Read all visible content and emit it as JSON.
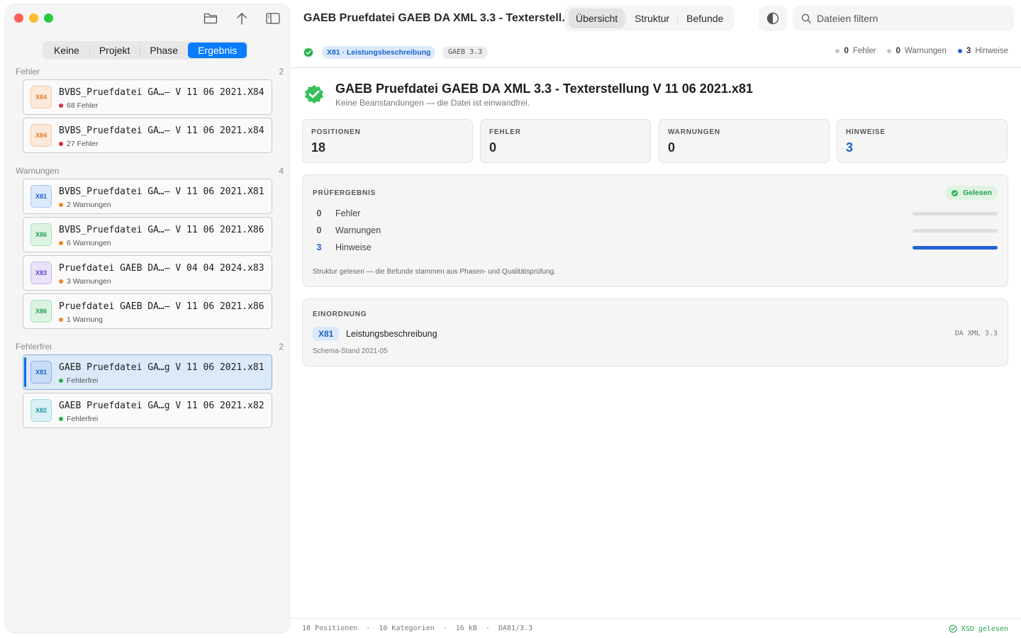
{
  "sidebar": {
    "tabs": [
      {
        "label": "Keine"
      },
      {
        "label": "Projekt"
      },
      {
        "label": "Phase"
      },
      {
        "label": "Ergebnis"
      }
    ],
    "groups": [
      {
        "label": "Fehler",
        "count": "2"
      },
      {
        "label": "Warnungen",
        "count": "4"
      },
      {
        "label": "Fehlerfrei",
        "count": "2"
      }
    ],
    "files": [
      {
        "badge": "X84",
        "name": "BVBS_Pruefdatei GA…– V 11 06 2021.X84",
        "status": "68 Fehler"
      },
      {
        "badge": "X84",
        "name": "BVBS_Pruefdatei GA…– V 11 06 2021.x84",
        "status": "27 Fehler"
      },
      {
        "badge": "X81",
        "name": "BVBS_Pruefdatei GA…– V 11 06 2021.X81",
        "status": "2 Warnungen"
      },
      {
        "badge": "X86",
        "name": "BVBS_Pruefdatei GA…– V 11 06 2021.X86",
        "status": "6 Warnungen"
      },
      {
        "badge": "X83",
        "name": "Pruefdatei GAEB DA…– V 04 04 2024.x83",
        "status": "3 Warnungen"
      },
      {
        "badge": "X86",
        "name": "Pruefdatei GAEB DA…– V 11 06 2021.x86",
        "status": "1 Warnung"
      },
      {
        "badge": "X81",
        "name": "GAEB Pruefdatei GA…g V 11 06 2021.x81",
        "status": "Fehlerfrei"
      },
      {
        "badge": "X82",
        "name": "GAEB Pruefdatei GA…g V 11 06 2021.x82",
        "status": "Fehlerfrei"
      }
    ]
  },
  "header": {
    "title": "GAEB Pruefdatei GAEB DA XML 3.3 - Texterstell...",
    "tabs": [
      {
        "label": "Übersicht"
      },
      {
        "label": "Struktur"
      },
      {
        "label": "Befunde"
      }
    ],
    "search_placeholder": "Dateien filtern"
  },
  "subbar": {
    "type_chip": "X81 · Leistungsbeschreibung",
    "version_chip": "GAEB 3.3",
    "counts": [
      {
        "num": "0",
        "label": "Fehler"
      },
      {
        "num": "0",
        "label": "Warnungen"
      },
      {
        "num": "3",
        "label": "Hinweise"
      }
    ]
  },
  "hero": {
    "title": "GAEB Pruefdatei GAEB DA XML 3.3 - Texterstellung V 11 06 2021.x81",
    "subtitle": "Keine Beanstandungen — die Datei ist einwandfrei."
  },
  "stats": [
    {
      "label": "POSITIONEN",
      "value": "18"
    },
    {
      "label": "FEHLER",
      "value": "0"
    },
    {
      "label": "WARNUNGEN",
      "value": "0"
    },
    {
      "label": "HINWEISE",
      "value": "3"
    }
  ],
  "result": {
    "label": "PRÜFERGEBNIS",
    "badge": "Gelesen",
    "rows": [
      {
        "num": "0",
        "name": "Fehler",
        "fill": 0
      },
      {
        "num": "0",
        "name": "Warnungen",
        "fill": 0
      },
      {
        "num": "3",
        "name": "Hinweise",
        "fill": 1
      }
    ],
    "note": "Struktur gelesen — die Befunde stammen aus Phasen- und Qualitätsprüfung."
  },
  "einordnung": {
    "label": "EINORDNUNG",
    "chip": "X81",
    "name": "Leistungsbeschreibung",
    "right": "DA XML 3.3",
    "sub": "Schema-Stand 2021-05"
  },
  "footer": {
    "left": "18 Positionen  ·  10 Kategorien  ·  16 kB  ·  DA81/3.3",
    "right": "XSD gelesen"
  },
  "colors": {
    "accent": "#0a7cff",
    "error": "#e5283d",
    "warning": "#f08a24",
    "ok": "#28b14c",
    "hint": "#1f62d2"
  }
}
